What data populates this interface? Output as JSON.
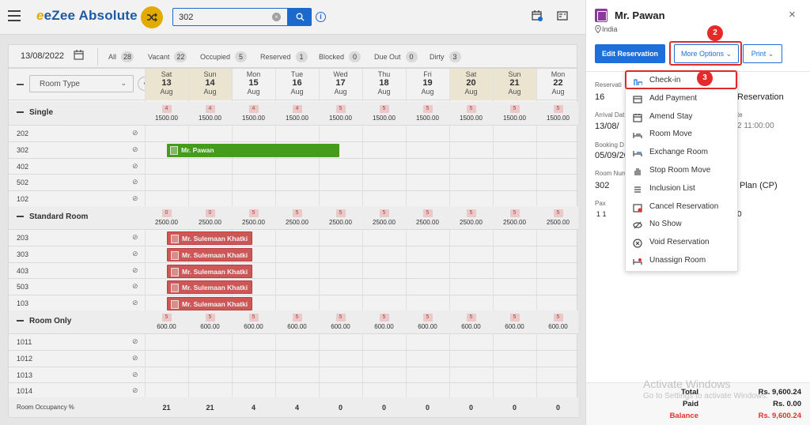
{
  "app": {
    "title": "eZee Absolute"
  },
  "search": {
    "value": "302"
  },
  "filters": {
    "date": "13/08/2022",
    "items": [
      {
        "label": "All",
        "count": "28"
      },
      {
        "label": "Vacant",
        "count": "22"
      },
      {
        "label": "Occupied",
        "count": "5"
      },
      {
        "label": "Reserved",
        "count": "1"
      },
      {
        "label": "Blocked",
        "count": "0"
      },
      {
        "label": "Due Out",
        "count": "0"
      },
      {
        "label": "Dirty",
        "count": "3"
      }
    ]
  },
  "grid": {
    "room_type_select": "Room Type",
    "days": [
      {
        "dow": "Sat",
        "day": "13",
        "mon": "Aug"
      },
      {
        "dow": "Sun",
        "day": "14",
        "mon": "Aug"
      },
      {
        "dow": "Mon",
        "day": "15",
        "mon": "Aug"
      },
      {
        "dow": "Tue",
        "day": "16",
        "mon": "Aug"
      },
      {
        "dow": "Wed",
        "day": "17",
        "mon": "Aug"
      },
      {
        "dow": "Thu",
        "day": "18",
        "mon": "Aug"
      },
      {
        "dow": "Fri",
        "day": "19",
        "mon": "Aug"
      },
      {
        "dow": "Sat",
        "day": "20",
        "mon": "Aug"
      },
      {
        "dow": "Sun",
        "day": "21",
        "mon": "Aug"
      },
      {
        "dow": "Mon",
        "day": "22",
        "mon": "Aug"
      }
    ],
    "groups": [
      {
        "name": "Single",
        "avail": [
          "4",
          "4",
          "4",
          "4",
          "5",
          "5",
          "5",
          "5",
          "5",
          "5"
        ],
        "rates": [
          "1500.00",
          "1500.00",
          "1500.00",
          "1500.00",
          "1500.00",
          "1500.00",
          "1500.00",
          "1500.00",
          "1500.00",
          "1500.00"
        ],
        "rooms": [
          "202",
          "302",
          "402",
          "502",
          "102"
        ]
      },
      {
        "name": "Standard Room",
        "avail": [
          "0",
          "0",
          "5",
          "5",
          "5",
          "5",
          "5",
          "5",
          "5",
          "5"
        ],
        "rates": [
          "2500.00",
          "2500.00",
          "2500.00",
          "2500.00",
          "2500.00",
          "2500.00",
          "2500.00",
          "2500.00",
          "2500.00",
          "2500.00"
        ],
        "rooms": [
          "203",
          "303",
          "403",
          "503",
          "103"
        ]
      },
      {
        "name": "Room Only",
        "avail": [
          "5",
          "5",
          "5",
          "5",
          "5",
          "5",
          "5",
          "5",
          "5",
          "5"
        ],
        "rates": [
          "600.00",
          "600.00",
          "600.00",
          "600.00",
          "600.00",
          "600.00",
          "600.00",
          "600.00",
          "600.00",
          "600.00"
        ],
        "rooms": [
          "1011",
          "1012",
          "1013",
          "1014"
        ]
      }
    ],
    "bookings": {
      "pawan": "Mr. Pawan",
      "sulemaan": "Mr. Sulemaan Khatki"
    },
    "occupancy_label": "Room Occupancy %",
    "occupancy": [
      "21",
      "21",
      "4",
      "4",
      "0",
      "0",
      "0",
      "0",
      "0",
      "0"
    ]
  },
  "panel": {
    "guest_name": "Mr. Pawan",
    "country": "India",
    "edit_button": "Edit Reservation",
    "more_options": "More Options",
    "print": "Print",
    "fields": {
      "res_label": "Reservati",
      "res_value": "16",
      "res_type_value": "Reservation",
      "arrival_label": "Arrival Dat",
      "arrival_value": "13/08/",
      "dep_label": "te",
      "dep_value": "2 11:00:00",
      "booking_label": "Booking D",
      "booking_value": "05/09/20",
      "roomnum_label": "Room Num",
      "roomnum_value": "302",
      "plan_value": "Plan (CP)",
      "pax_label": "Pax",
      "pax_value": "1   1",
      "pax_right": "0"
    },
    "totals": {
      "total_label": "Total",
      "total_value": "Rs. 9,600.24",
      "paid_label": "Paid",
      "paid_value": "Rs. 0.00",
      "balance_label": "Balance",
      "balance_value": "Rs. 9,600.24"
    }
  },
  "dropdown": {
    "items": [
      {
        "label": "Check-in",
        "icon": "checkin-icon"
      },
      {
        "label": "Add Payment",
        "icon": "payment-icon"
      },
      {
        "label": "Amend Stay",
        "icon": "calendar-icon"
      },
      {
        "label": "Room Move",
        "icon": "bed-move-icon"
      },
      {
        "label": "Exchange Room",
        "icon": "exchange-icon"
      },
      {
        "label": "Stop Room Move",
        "icon": "hand-stop-icon"
      },
      {
        "label": "Inclusion List",
        "icon": "list-icon"
      },
      {
        "label": "Cancel Reservation",
        "icon": "calendar-cancel-icon"
      },
      {
        "label": "No Show",
        "icon": "eye-off-icon"
      },
      {
        "label": "Void Reservation",
        "icon": "circle-x-icon"
      },
      {
        "label": "Unassign Room",
        "icon": "bed-unassign-icon"
      }
    ]
  },
  "callouts": {
    "two": "2",
    "three": "3"
  },
  "watermark": {
    "line1": "Activate Windows",
    "line2": "Go to Settings to activate Windows."
  },
  "colors": {
    "brand": "#1e6fd9",
    "accent": "#f0b400",
    "booking_green": "#49a51e",
    "booking_red": "#d95c5c",
    "callout": "#e62a2a"
  }
}
